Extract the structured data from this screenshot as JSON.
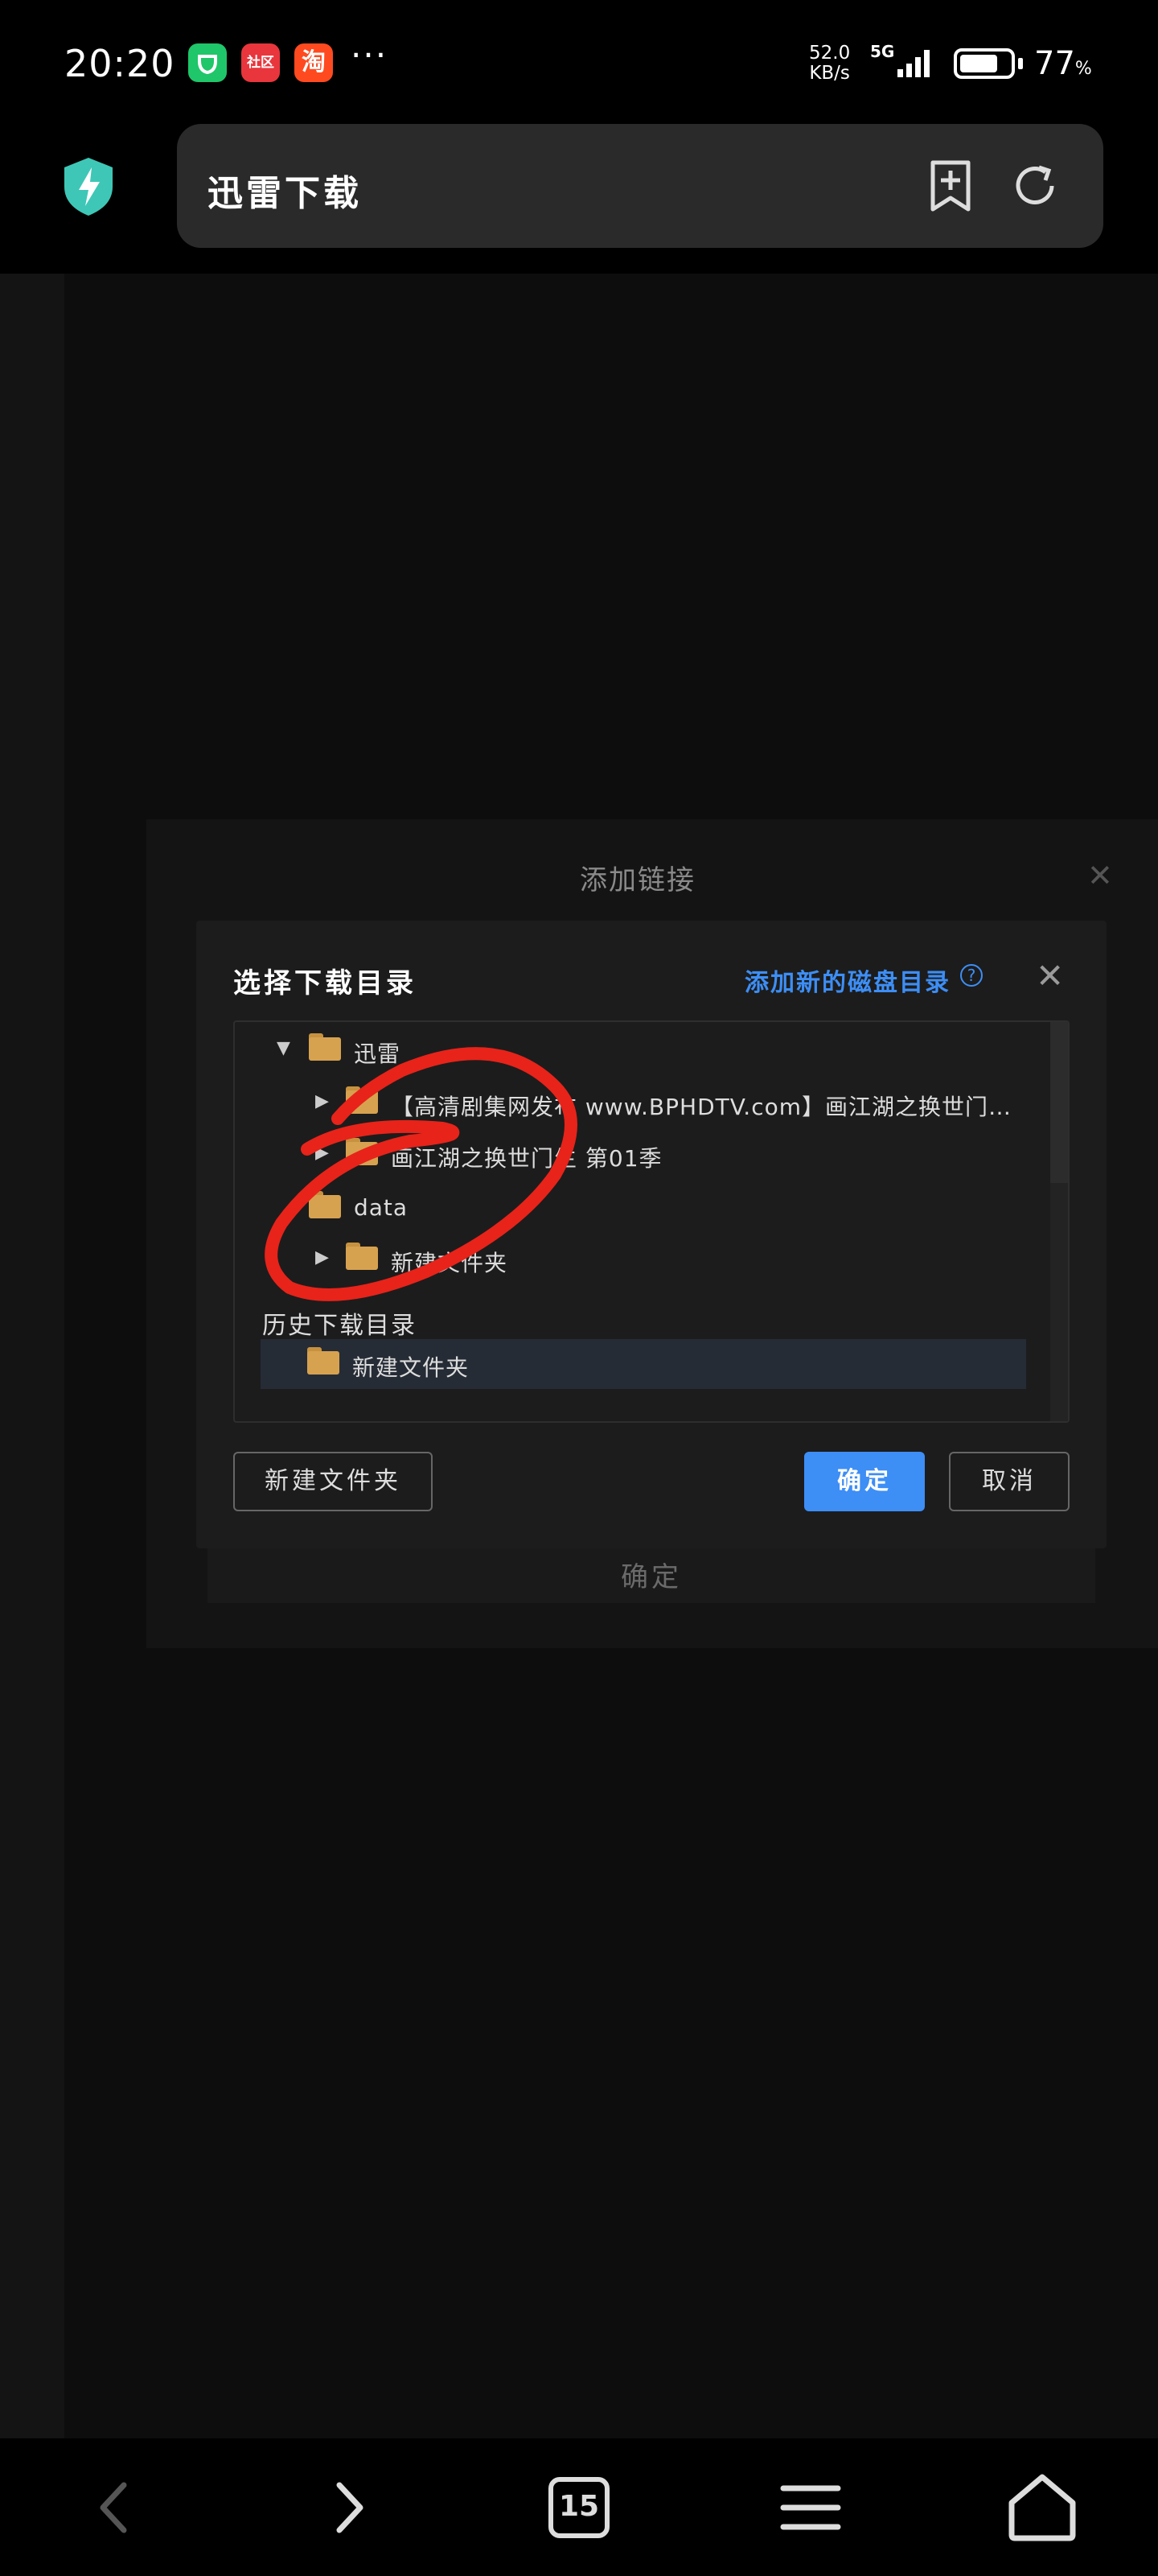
{
  "status_bar": {
    "time": "20:20",
    "app_badges": [
      "mi-home",
      "社区",
      "淘"
    ],
    "more": "···",
    "net_speed_value": "52.0",
    "net_speed_unit": "KB/s",
    "network": "5G",
    "battery_percent": "77",
    "battery_unit": "%",
    "battery_level": 0.77
  },
  "browser": {
    "url_title": "迅雷下载",
    "icons": [
      "shield-bolt-icon",
      "bookmark-add-icon",
      "reload-icon"
    ]
  },
  "outer_dialog": {
    "title": "添加链接",
    "confirm_label": "确定"
  },
  "inner_dialog": {
    "title": "选择下载目录",
    "add_disk_link": "添加新的磁盘目录",
    "help": "?",
    "tree": [
      {
        "label": "迅雷",
        "expanded": true
      },
      {
        "label": "【高清剧集网发布 www.BPHDTV.com】画江湖之换世门…",
        "expanded": false
      },
      {
        "label": "画江湖之换世门生 第01季",
        "expanded": false
      },
      {
        "label": "data",
        "expanded": false
      },
      {
        "label": "新建文件夹",
        "expanded": false
      }
    ],
    "history_label": "历史下载目录",
    "history_items": [
      "新建文件夹"
    ],
    "buttons": {
      "new_folder": "新建文件夹",
      "ok": "确定",
      "cancel": "取消"
    }
  },
  "bottom_nav": {
    "tab_count": "15",
    "icons": [
      "back-icon",
      "forward-icon",
      "tabs-icon",
      "menu-icon",
      "home-icon"
    ]
  },
  "colors": {
    "accent": "#3d8ef5",
    "folder": "#d7a24f",
    "annotation": "#e8231a"
  }
}
